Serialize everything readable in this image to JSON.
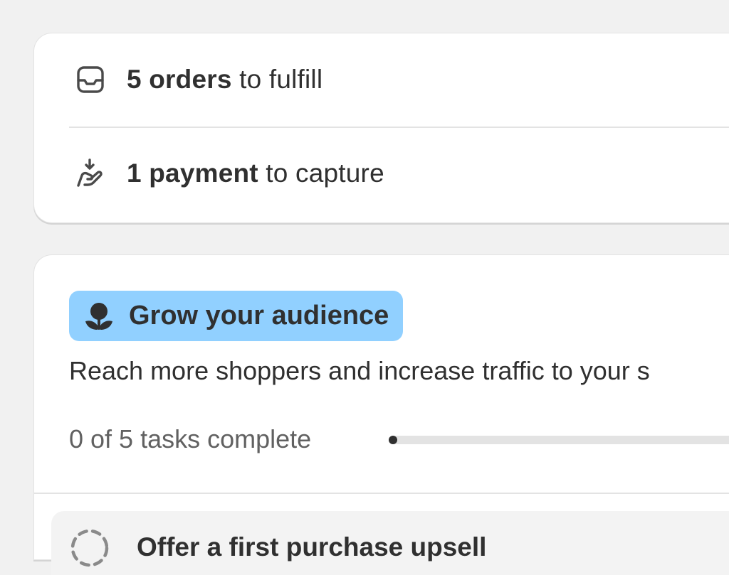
{
  "orders_card": {
    "fulfill": {
      "icon": "inbox-icon",
      "bold": "5 orders",
      "rest": " to fulfill"
    },
    "capture": {
      "icon": "hand-payment-icon",
      "bold": "1 payment",
      "rest": " to capture"
    }
  },
  "audience_card": {
    "badge": {
      "icon": "sprout-icon",
      "label": "Grow your audience",
      "color": "#91d0ff"
    },
    "description": "Reach more shoppers and increase traffic to your s",
    "progress": {
      "label": "0 of 5 tasks complete",
      "completed": 0,
      "total": 5
    },
    "tasks": [
      {
        "icon": "dashed-circle-icon",
        "title": "Offer a first purchase upsell"
      }
    ]
  }
}
